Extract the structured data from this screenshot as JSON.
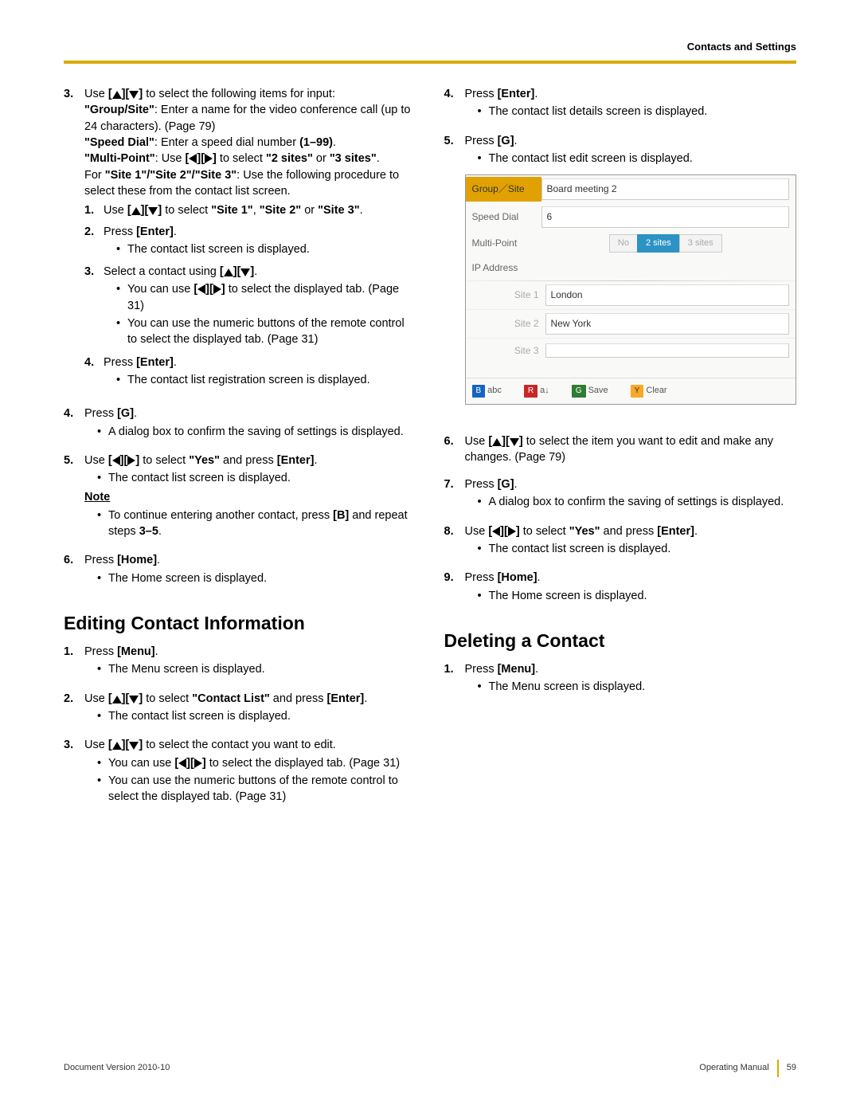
{
  "header": "Contacts and Settings",
  "left": {
    "step3": {
      "prefix": "Use ",
      "text_a": " to select the following items for input:",
      "group_site_label": "\"Group/Site\"",
      "group_site_text": ": Enter a name for the video conference call (up to 24 characters). (Page 79)",
      "speed_dial_label": "\"Speed Dial\"",
      "speed_dial_text": ": Enter a speed dial number ",
      "speed_dial_range": "(1–99)",
      "multipoint_label": "\"Multi-Point\"",
      "multipoint_text_a": ": Use ",
      "multipoint_text_b": " to select ",
      "opt_2sites": "\"2 sites\"",
      "or": " or ",
      "opt_3sites": "\"3 sites\"",
      "dot": ".",
      "for_text_a": "For ",
      "sites_bold": "\"Site 1\"/\"Site 2\"/\"Site 3\"",
      "for_text_b": ": Use the following procedure to select these from the contact list screen.",
      "sub1": {
        "prefix": "Use ",
        "mid": " to select ",
        "a": "\"Site 1\"",
        "b": "\"Site 2\"",
        "c": "\"Site 3\"",
        "or": " or ",
        "comma": ", "
      },
      "sub2": {
        "text": "Press ",
        "enter": "[Enter]",
        "dot": ".",
        "bullet": "The contact list screen is displayed."
      },
      "sub3": {
        "text": "Select a contact using ",
        "bullet1a": "You can use ",
        "bullet1b": " to select the displayed tab. (Page 31)",
        "bullet2": "You can use the numeric buttons of the remote control to select the displayed tab. (Page 31)"
      },
      "sub4": {
        "text": "Press ",
        "enter": "[Enter]",
        "dot": ".",
        "bullet": "The contact list registration screen is displayed."
      }
    },
    "step4": {
      "text": "Press ",
      "g": "[G]",
      "dot": ".",
      "bullet": "A dialog box to confirm the saving of settings is displayed."
    },
    "step5": {
      "prefix": "Use ",
      "mid": " to select ",
      "yes": "\"Yes\"",
      "and": " and press ",
      "enter": "[Enter]",
      "dot": ".",
      "bullet": "The contact list screen is displayed.",
      "note_label": "Note",
      "note_text": "To continue entering another contact, press ",
      "note_b": "[B]",
      "note_rest": " and repeat steps ",
      "note_steps": "3–5",
      "note_dot": "."
    },
    "step6": {
      "text": "Press ",
      "home": "[Home]",
      "dot": ".",
      "bullet": "The Home screen is displayed."
    },
    "section_title": "Editing Contact Information",
    "e1": {
      "text": "Press ",
      "menu": "[Menu]",
      "dot": ".",
      "bullet": "The Menu screen is displayed."
    },
    "e2": {
      "prefix": "Use ",
      "mid": " to select ",
      "cl": "\"Contact List\"",
      "and": " and press ",
      "enter": "[Enter]",
      "dot": ".",
      "bullet": "The contact list screen is displayed."
    },
    "e3": {
      "prefix": "Use ",
      "mid": " to select the contact you want to edit.",
      "bullet1a": "You can use ",
      "bullet1b": " to select the displayed tab. (Page 31)",
      "bullet2": "You can use the numeric buttons of the remote control to select the displayed tab. (Page 31)"
    }
  },
  "right": {
    "step4": {
      "text": "Press ",
      "enter": "[Enter]",
      "dot": ".",
      "bullet": "The contact list details screen is displayed."
    },
    "step5": {
      "text": "Press ",
      "g": "[G]",
      "dot": ".",
      "bullet": "The contact list edit screen is displayed."
    },
    "ui": {
      "group_site_label": "Group／Site",
      "group_site_value": "Board meeting 2",
      "speed_dial_label": "Speed Dial",
      "speed_dial_value": "6",
      "multipoint_label": "Multi-Point",
      "seg_no": "No",
      "seg_2": "2 sites",
      "seg_3": "3 sites",
      "ip_label": "IP Address",
      "site1_label": "Site 1",
      "site1_value": "London",
      "site2_label": "Site 2",
      "site2_value": "New York",
      "site3_label": "Site 3",
      "site3_value": "",
      "btn_b": "B",
      "btn_b_txt": "abc",
      "btn_r": "R",
      "btn_r_txt": "a↓",
      "btn_g": "G",
      "btn_g_txt": "Save",
      "btn_y": "Y",
      "btn_y_txt": "Clear"
    },
    "step6": {
      "prefix": "Use ",
      "mid": " to select the item you want to edit and make any changes. (Page 79)"
    },
    "step7": {
      "text": "Press ",
      "g": "[G]",
      "dot": ".",
      "bullet": "A dialog box to confirm the saving of settings is displayed."
    },
    "step8": {
      "prefix": "Use ",
      "mid": " to select ",
      "yes": "\"Yes\"",
      "and": " and press ",
      "enter": "[Enter]",
      "dot": ".",
      "bullet": "The contact list screen is displayed."
    },
    "step9": {
      "text": "Press ",
      "home": "[Home]",
      "dot": ".",
      "bullet": "The Home screen is displayed."
    },
    "section_title": "Deleting a Contact",
    "d1": {
      "text": "Press ",
      "menu": "[Menu]",
      "dot": ".",
      "bullet": "The Menu screen is displayed."
    }
  },
  "footer": {
    "left": "Document Version  2010-10",
    "right_label": "Operating Manual",
    "page": "59"
  }
}
